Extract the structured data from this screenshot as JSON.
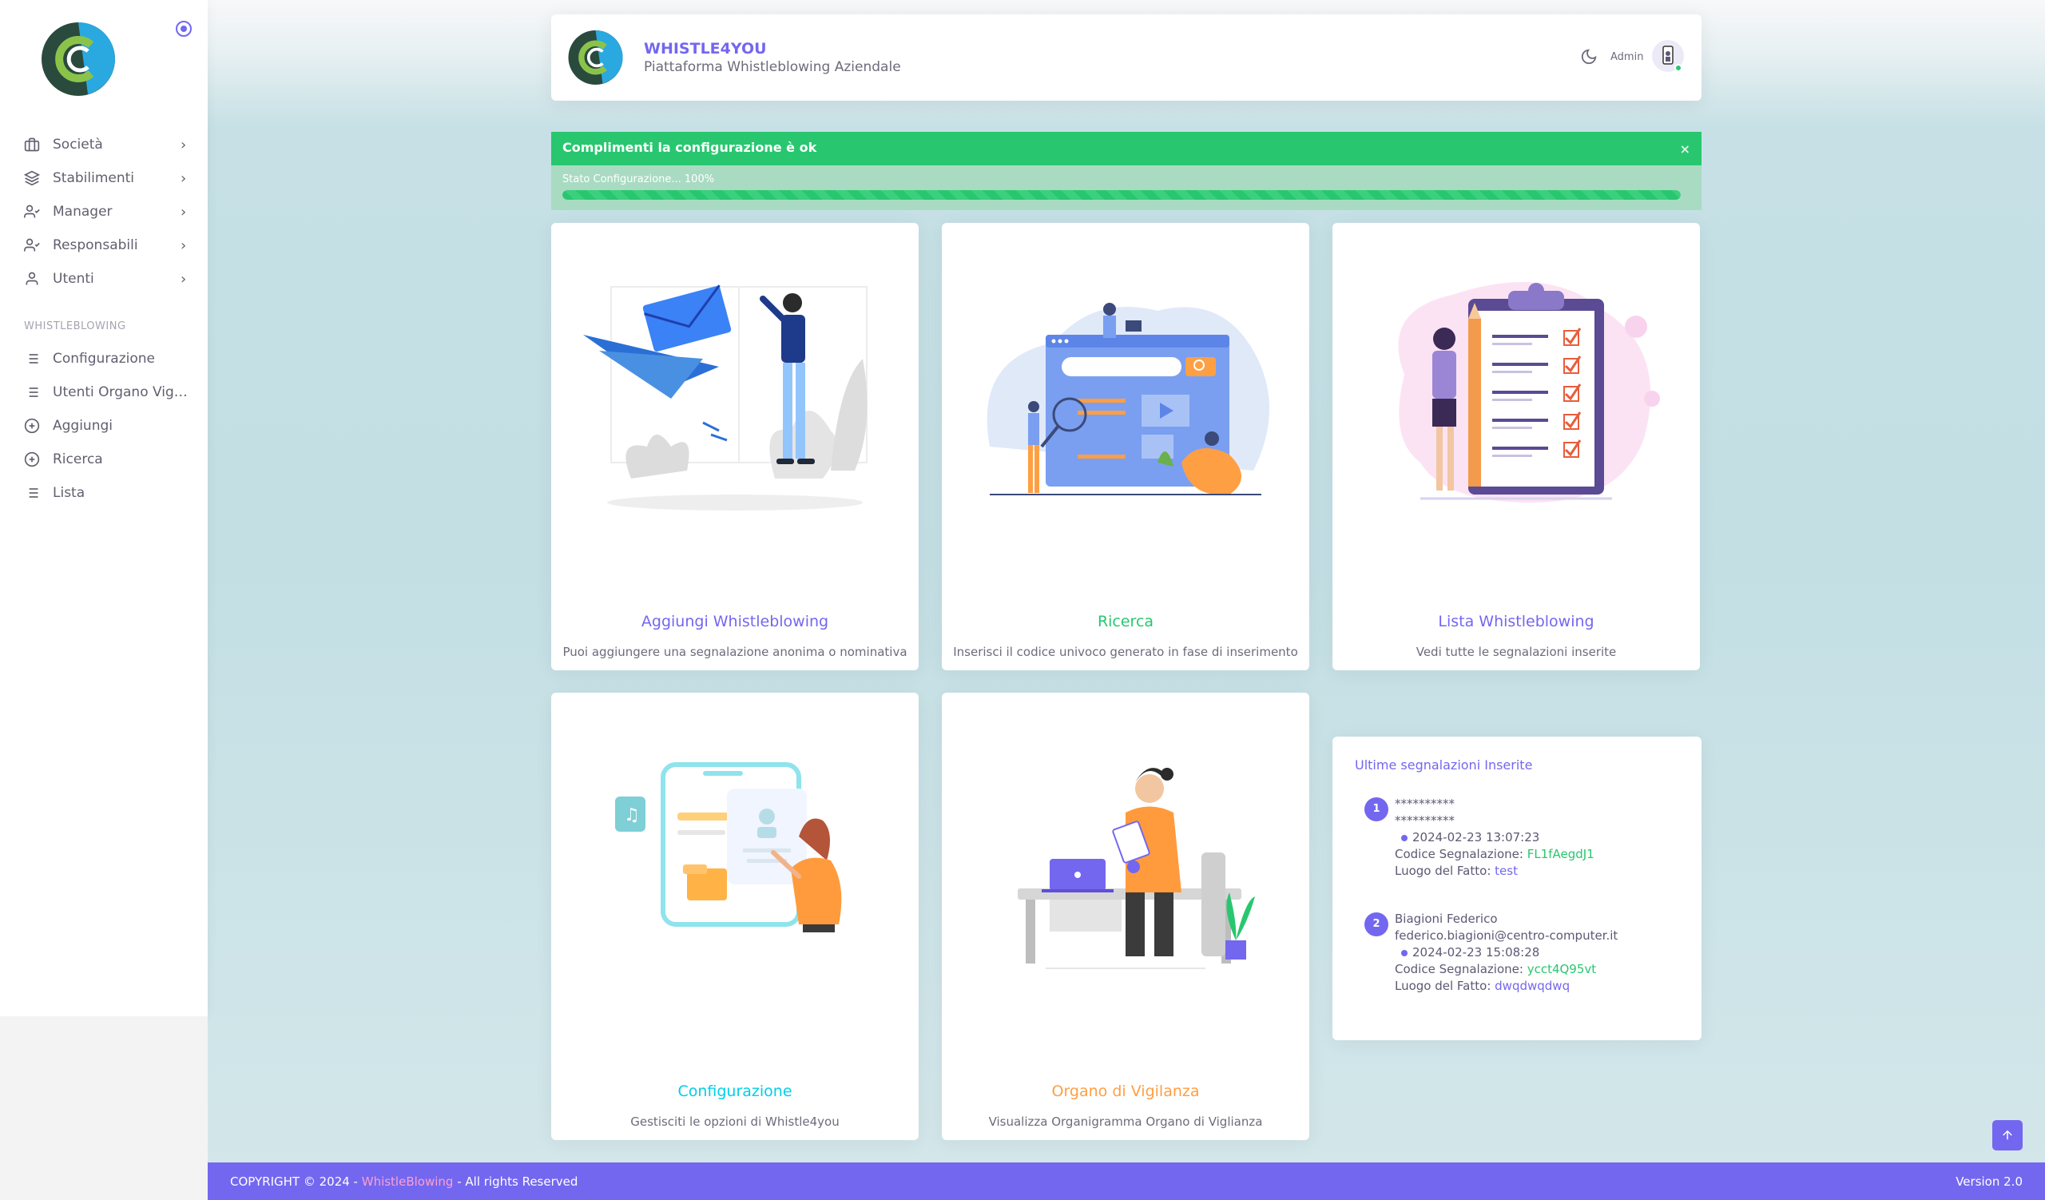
{
  "sidebar": {
    "items": [
      {
        "label": "Società",
        "icon": "briefcase-icon"
      },
      {
        "label": "Stabilimenti",
        "icon": "layers-icon"
      },
      {
        "label": "Manager",
        "icon": "user-check-icon"
      },
      {
        "label": "Responsabili",
        "icon": "user-check-icon"
      },
      {
        "label": "Utenti",
        "icon": "user-icon"
      }
    ],
    "section_header": "WHISTLEBLOWING",
    "section_items": [
      {
        "label": "Configurazione",
        "icon": "list-icon"
      },
      {
        "label": "Utenti Organo Vigil...",
        "icon": "list-icon"
      },
      {
        "label": "Aggiungi",
        "icon": "plus-circle-icon"
      },
      {
        "label": "Ricerca",
        "icon": "plus-circle-icon"
      },
      {
        "label": "Lista",
        "icon": "list-icon"
      }
    ]
  },
  "header": {
    "title": "WHISTLE4YOU",
    "subtitle": "Piattaforma Whistleblowing Aziendale",
    "user_label": "Admin"
  },
  "alert": {
    "message": "Complimenti la configurazione è ok",
    "close": "×",
    "progress_label": "Stato Configurazione... 100%",
    "progress_value": 100
  },
  "cards": [
    {
      "title": "Aggiungi Whistleblowing",
      "desc": "Puoi aggiungere una segnalazione anonima o nominativa",
      "color": "#7367f0"
    },
    {
      "title": "Ricerca",
      "desc": "Inserisci il codice univoco generato in fase di inserimento",
      "color": "#28c76f"
    },
    {
      "title": "Lista Whistleblowing",
      "desc": "Vedi tutte le segnalazioni inserite",
      "color": "#7367f0"
    },
    {
      "title": "Configurazione",
      "desc": "Gestisciti le opzioni di Whistle4you",
      "color": "#00cfe8"
    },
    {
      "title": "Organo di Vigilanza",
      "desc": "Visualizza Organigramma Organo di Viglianza",
      "color": "#ff9f43"
    }
  ],
  "recent": {
    "title": "Ultime segnalazioni Inserite",
    "entries": [
      {
        "num": "1",
        "name": "**********",
        "email": "**********",
        "date": "2024-02-23 13:07:23",
        "code_label": "Codice Segnalazione:",
        "code": "FL1fAegdJ1",
        "place_label": "Luogo del Fatto:",
        "place": "test"
      },
      {
        "num": "2",
        "name": "Biagioni Federico",
        "email": "federico.biagioni@centro-computer.it",
        "date": "2024-02-23 15:08:28",
        "code_label": "Codice Segnalazione:",
        "code": "ycct4Q95vt",
        "place_label": "Luogo del Fatto:",
        "place": "dwqdwqdwq"
      }
    ]
  },
  "footer": {
    "prefix": "COPYRIGHT © 2024 - ",
    "brand": "WhistleBlowing",
    "suffix": " - All rights Reserved",
    "version": "Version 2.0"
  },
  "colors": {
    "accent": "#7367f0",
    "success": "#28c76f",
    "info": "#00cfe8",
    "warning": "#ff9f43"
  },
  "scroll_top_icon": "arrow-up-icon"
}
